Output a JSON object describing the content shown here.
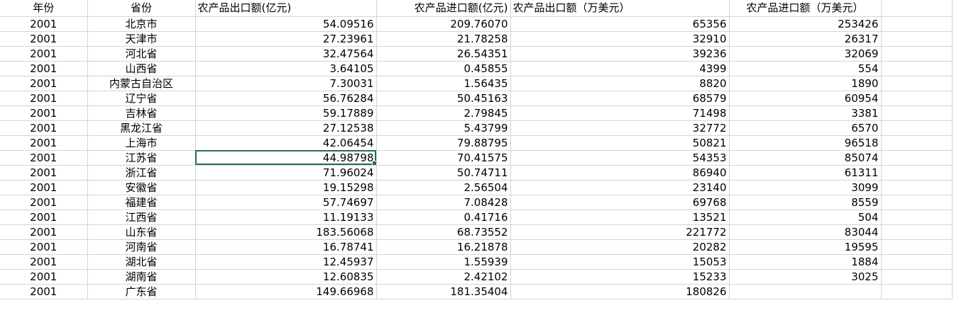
{
  "columns": [
    "年份",
    "省份",
    "农产品出口额(亿元)",
    "农产品进口额(亿元)",
    "农产品出口额（万美元）",
    "农产品进口额（万美元）"
  ],
  "rows": [
    [
      "2001",
      "北京市",
      "54.09516",
      "209.76070",
      "65356",
      "253426"
    ],
    [
      "2001",
      "天津市",
      "27.23961",
      "21.78258",
      "32910",
      "26317"
    ],
    [
      "2001",
      "河北省",
      "32.47564",
      "26.54351",
      "39236",
      "32069"
    ],
    [
      "2001",
      "山西省",
      "3.64105",
      "0.45855",
      "4399",
      "554"
    ],
    [
      "2001",
      "内蒙古自治区",
      "7.30031",
      "1.56435",
      "8820",
      "1890"
    ],
    [
      "2001",
      "辽宁省",
      "56.76284",
      "50.45163",
      "68579",
      "60954"
    ],
    [
      "2001",
      "吉林省",
      "59.17889",
      "2.79845",
      "71498",
      "3381"
    ],
    [
      "2001",
      "黑龙江省",
      "27.12538",
      "5.43799",
      "32772",
      "6570"
    ],
    [
      "2001",
      "上海市",
      "42.06454",
      "79.88795",
      "50821",
      "96518"
    ],
    [
      "2001",
      "江苏省",
      "44.98798",
      "70.41575",
      "54353",
      "85074"
    ],
    [
      "2001",
      "浙江省",
      "71.96024",
      "50.74711",
      "86940",
      "61311"
    ],
    [
      "2001",
      "安徽省",
      "19.15298",
      "2.56504",
      "23140",
      "3099"
    ],
    [
      "2001",
      "福建省",
      "57.74697",
      "7.08428",
      "69768",
      "8559"
    ],
    [
      "2001",
      "江西省",
      "11.19133",
      "0.41716",
      "13521",
      "504"
    ],
    [
      "2001",
      "山东省",
      "183.56068",
      "68.73552",
      "221772",
      "83044"
    ],
    [
      "2001",
      "河南省",
      "16.78741",
      "16.21878",
      "20282",
      "19595"
    ],
    [
      "2001",
      "湖北省",
      "12.45937",
      "1.55939",
      "15053",
      "1884"
    ],
    [
      "2001",
      "湖南省",
      "12.60835",
      "2.42102",
      "15233",
      "3025"
    ],
    [
      "2001",
      "广东省",
      "149.66968",
      "181.35404",
      "180826",
      ""
    ]
  ],
  "selected_cell": {
    "row": 9,
    "col": 2
  },
  "colors": {
    "selection": "#1f7244",
    "gridline": "#d4d4d4"
  }
}
